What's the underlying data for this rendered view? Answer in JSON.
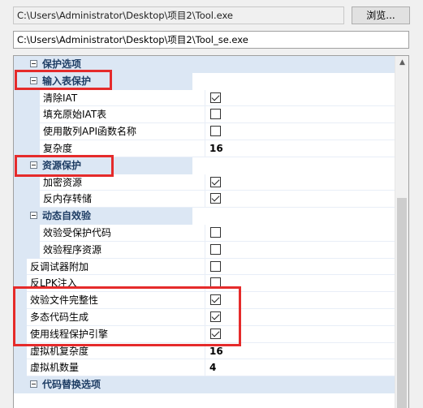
{
  "input_path": "C:\\Users\\Administrator\\Desktop\\项目2\\Tool.exe",
  "output_path": "C:\\Users\\Administrator\\Desktop\\项目2\\Tool_se.exe",
  "browse_label": "浏览...",
  "colors": {
    "highlight": "#e52b2b",
    "category_bg": "#dce7f4"
  },
  "rows": [
    {
      "kind": "cat",
      "label": "保护选项"
    },
    {
      "kind": "sub",
      "label": "输入表保护"
    },
    {
      "kind": "prop",
      "label": "清除IAT",
      "checked": true
    },
    {
      "kind": "prop",
      "label": "填充原始IAT表",
      "checked": false
    },
    {
      "kind": "prop",
      "label": "使用散列API函数名称",
      "checked": false
    },
    {
      "kind": "prop",
      "label": "复杂度",
      "value": "16"
    },
    {
      "kind": "sub",
      "label": "资源保护"
    },
    {
      "kind": "prop",
      "label": "加密资源",
      "checked": true
    },
    {
      "kind": "prop",
      "label": "反内存转储",
      "checked": true
    },
    {
      "kind": "sub",
      "label": "动态自效验"
    },
    {
      "kind": "prop",
      "label": "效验受保护代码",
      "checked": false
    },
    {
      "kind": "prop",
      "label": "效验程序资源",
      "checked": false
    },
    {
      "kind": "prop0",
      "label": "反调试器附加",
      "checked": false
    },
    {
      "kind": "prop0",
      "label": "反LPK注入",
      "checked": false
    },
    {
      "kind": "prop0",
      "label": "效验文件完整性",
      "checked": true
    },
    {
      "kind": "prop0",
      "label": "多态代码生成",
      "checked": true
    },
    {
      "kind": "prop0",
      "label": "使用线程保护引擎",
      "checked": true
    },
    {
      "kind": "prop0",
      "label": "虚拟机复杂度",
      "value": "16"
    },
    {
      "kind": "prop0",
      "label": "虚拟机数量",
      "value": "4"
    },
    {
      "kind": "cat",
      "label": "代码替换选项"
    }
  ]
}
